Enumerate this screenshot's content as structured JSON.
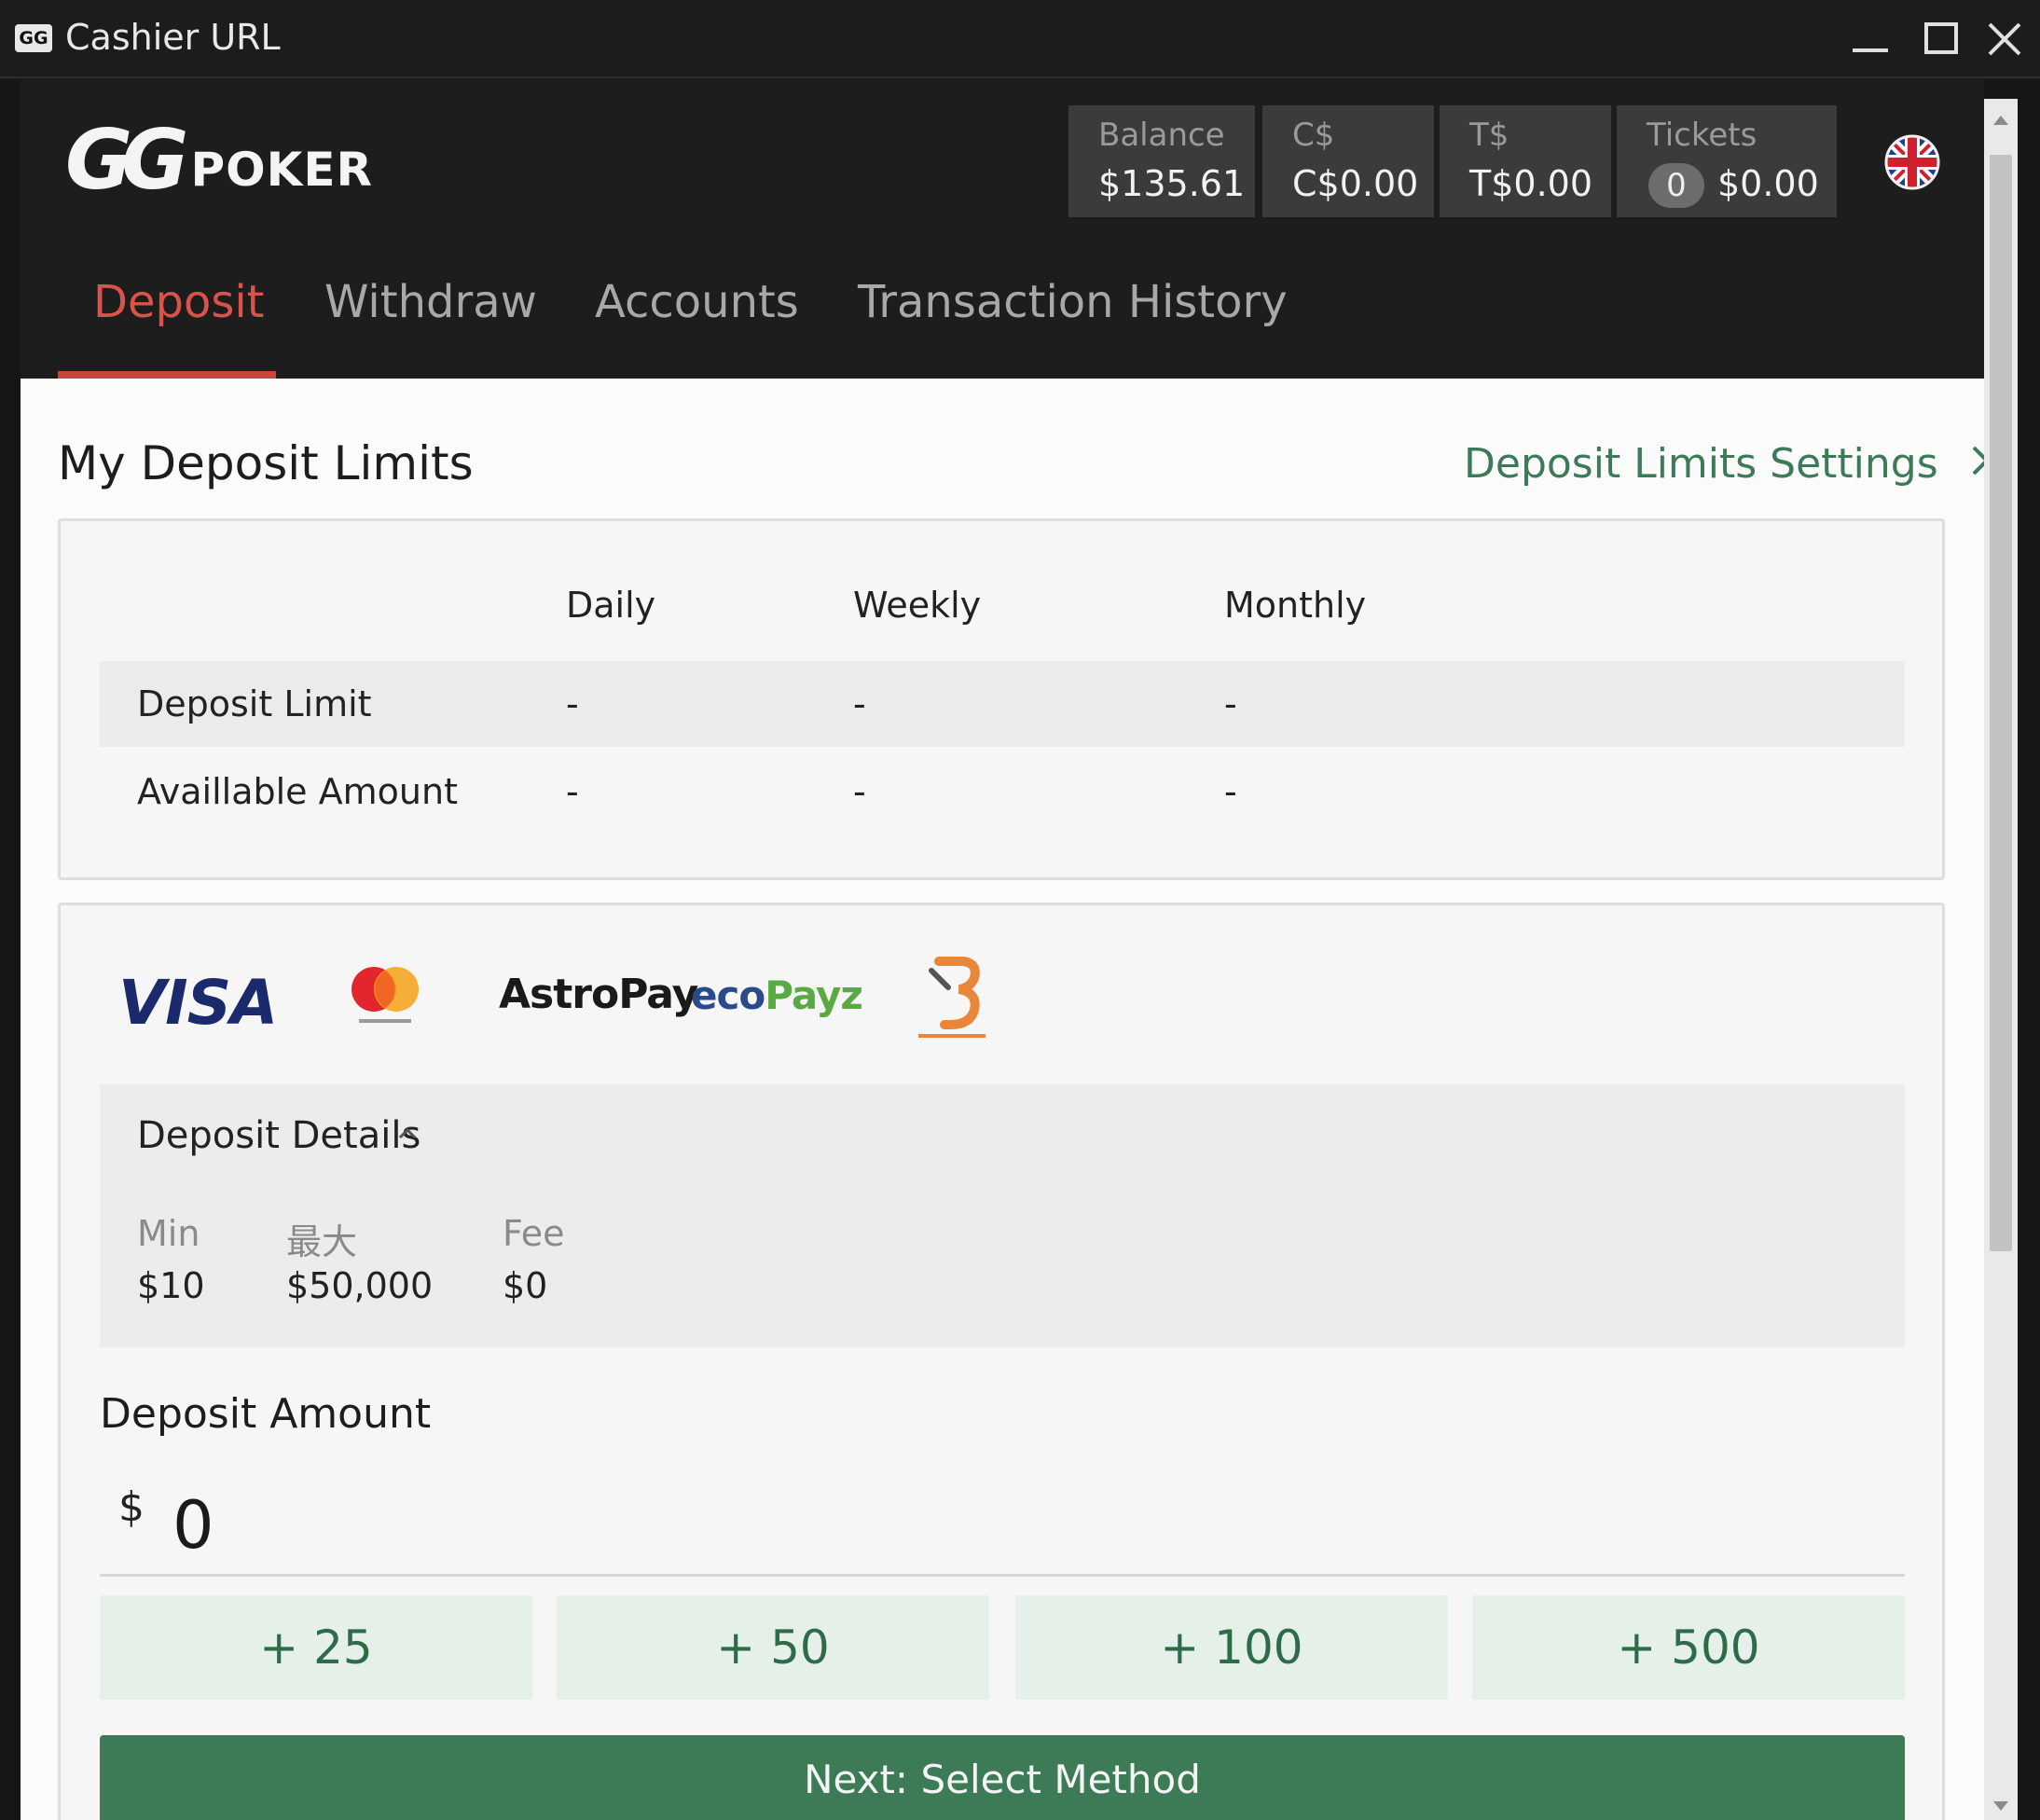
{
  "window": {
    "app_icon_text": "GG",
    "title": "Cashier URL",
    "icons": [
      "minimize-icon",
      "maximize-icon",
      "close-icon"
    ]
  },
  "brand": {
    "logo_gg": "GG",
    "logo_poker": "POKER"
  },
  "balances": {
    "balance_label": "Balance",
    "balance_value": "$135.61",
    "cash_label": "C$",
    "cash_value": "C$0.00",
    "tournament_label": "T$",
    "tournament_value": "T$0.00",
    "tickets_label": "Tickets",
    "tickets_count": "0",
    "tickets_value": "$0.00"
  },
  "language_icon": "uk-flag-icon",
  "tabs": [
    {
      "label": "Deposit",
      "active": true
    },
    {
      "label": "Withdraw",
      "active": false
    },
    {
      "label": "Accounts",
      "active": false
    },
    {
      "label": "Transaction History",
      "active": false
    }
  ],
  "limits": {
    "title": "My Deposit Limits",
    "settings_link": "Deposit Limits Settings",
    "columns": [
      "Daily",
      "Weekly",
      "Monthly"
    ],
    "rows": [
      {
        "label": "Deposit Limit",
        "values": [
          "-",
          "-",
          "-"
        ]
      },
      {
        "label": "Availlable Amount",
        "values": [
          "-",
          "-",
          "-"
        ]
      }
    ]
  },
  "payment_methods": {
    "visa": "VISA",
    "mastercard_icon": "mastercard-icon",
    "astropay": "AstroPay",
    "ecopayz_eco": "eco",
    "ecopayz_payz": "Payz",
    "bitcoin_icon": "bitcoin-bitcoinbitzer-icon"
  },
  "deposit_details": {
    "title": "Deposit Details",
    "min_label": "Min",
    "min_value": "$10",
    "max_label": "最大",
    "max_value": "$50,000",
    "fee_label": "Fee",
    "fee_value": "$0"
  },
  "deposit_amount": {
    "title": "Deposit Amount",
    "currency": "$",
    "value": "0",
    "quick_add": [
      "+ 25",
      "+ 50",
      "+ 100",
      "+ 500"
    ],
    "next_label": "Next: Select Method"
  },
  "colors": {
    "active_tab": "#d9534a",
    "link_green": "#3c7a58",
    "next_button": "#3d7b57",
    "quick_button_bg": "#e4f0e8"
  }
}
